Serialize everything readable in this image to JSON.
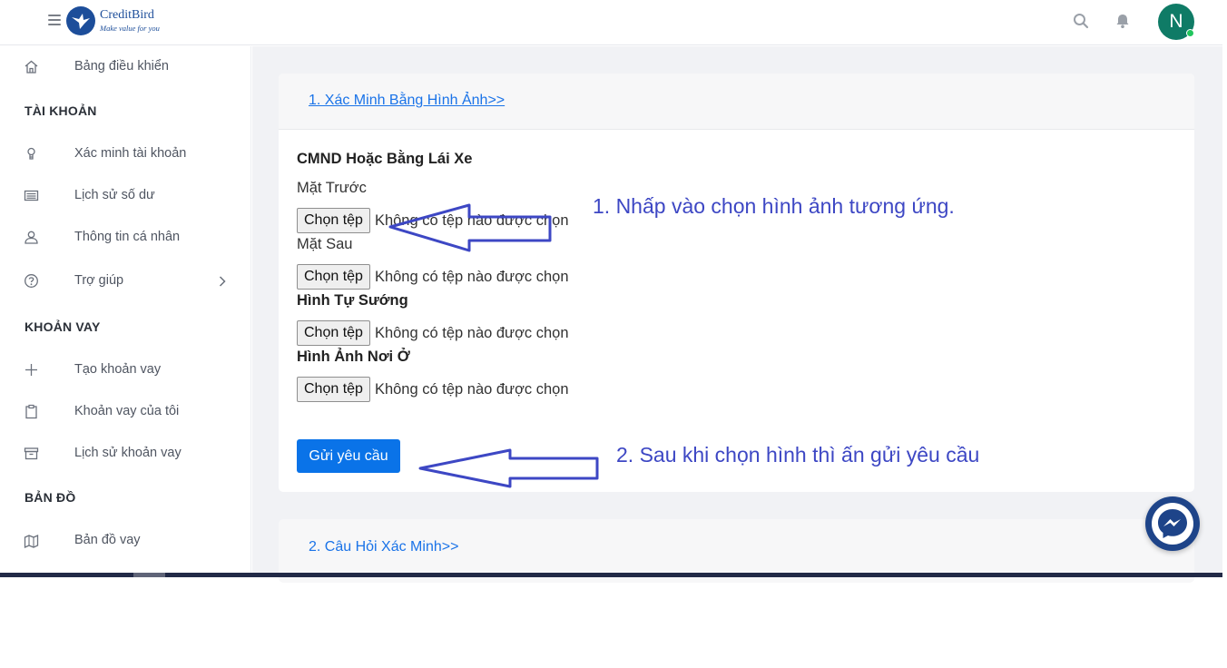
{
  "header": {
    "brand_name": "CreditBird",
    "brand_tagline": "Make value for you",
    "avatar_initial": "N"
  },
  "sidebar": {
    "dashboard": "Bảng điều khiển",
    "section_account": "TÀI KHOẢN",
    "verify_account": "Xác minh tài khoản",
    "balance_history": "Lịch sử số dư",
    "personal_info": "Thông tin cá nhân",
    "help": "Trợ giúp",
    "section_loan": "KHOẢN VAY",
    "create_loan": "Tạo khoản vay",
    "my_loans": "Khoản vay của tôi",
    "loan_history": "Lịch sử khoản vay",
    "section_map": "BẢN ĐỒ",
    "loan_map": "Bản đồ vay"
  },
  "main": {
    "step1_link": "1. Xác Minh Bằng Hình Ảnh>>",
    "id_title": "CMND Hoặc Bằng Lái Xe",
    "front_label": "Mặt Trước",
    "back_label": "Mặt Sau",
    "selfie_label": "Hình Tự Sướng",
    "residence_label": "Hình Ảnh Nơi Ở",
    "file_button": "Chọn tệp",
    "file_status": "Không có tệp nào được chọn",
    "submit_label": "Gửi yêu cầu",
    "step2_link": "2. Câu Hỏi Xác Minh>>"
  },
  "annotations": {
    "note1": "1. Nhấp vào chọn hình ảnh tương ứng.",
    "note2": "2. Sau khi chọn hình thì ấn gửi yêu cầu",
    "color": "#3d47c4"
  },
  "colors": {
    "primary": "#0a73e8",
    "link": "#1a73e8",
    "avatar": "#0f7b66",
    "brand": "#1d4e9a"
  }
}
